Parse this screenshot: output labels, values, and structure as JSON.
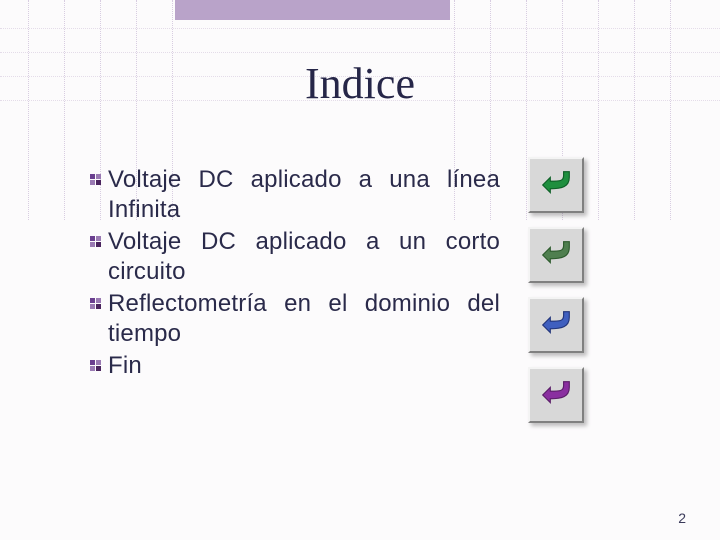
{
  "title": "Indice",
  "items": [
    {
      "text": "Voltaje DC aplicado a una línea Infinita"
    },
    {
      "text": "Voltaje DC aplicado a un corto circuito"
    },
    {
      "text": "Reflectometría en el dominio del tiempo"
    },
    {
      "text": "Fin"
    }
  ],
  "buttons": [
    {
      "icon": "u-turn-icon",
      "color": "#1f8f3f",
      "dark": "#0d5f26"
    },
    {
      "icon": "u-turn-icon",
      "color": "#4f7f4f",
      "dark": "#2c5a2c"
    },
    {
      "icon": "u-turn-icon",
      "color": "#3f5fbf",
      "dark": "#22357a"
    },
    {
      "icon": "u-turn-icon",
      "color": "#8a2fa0",
      "dark": "#5a1d68"
    }
  ],
  "page_number": "2"
}
